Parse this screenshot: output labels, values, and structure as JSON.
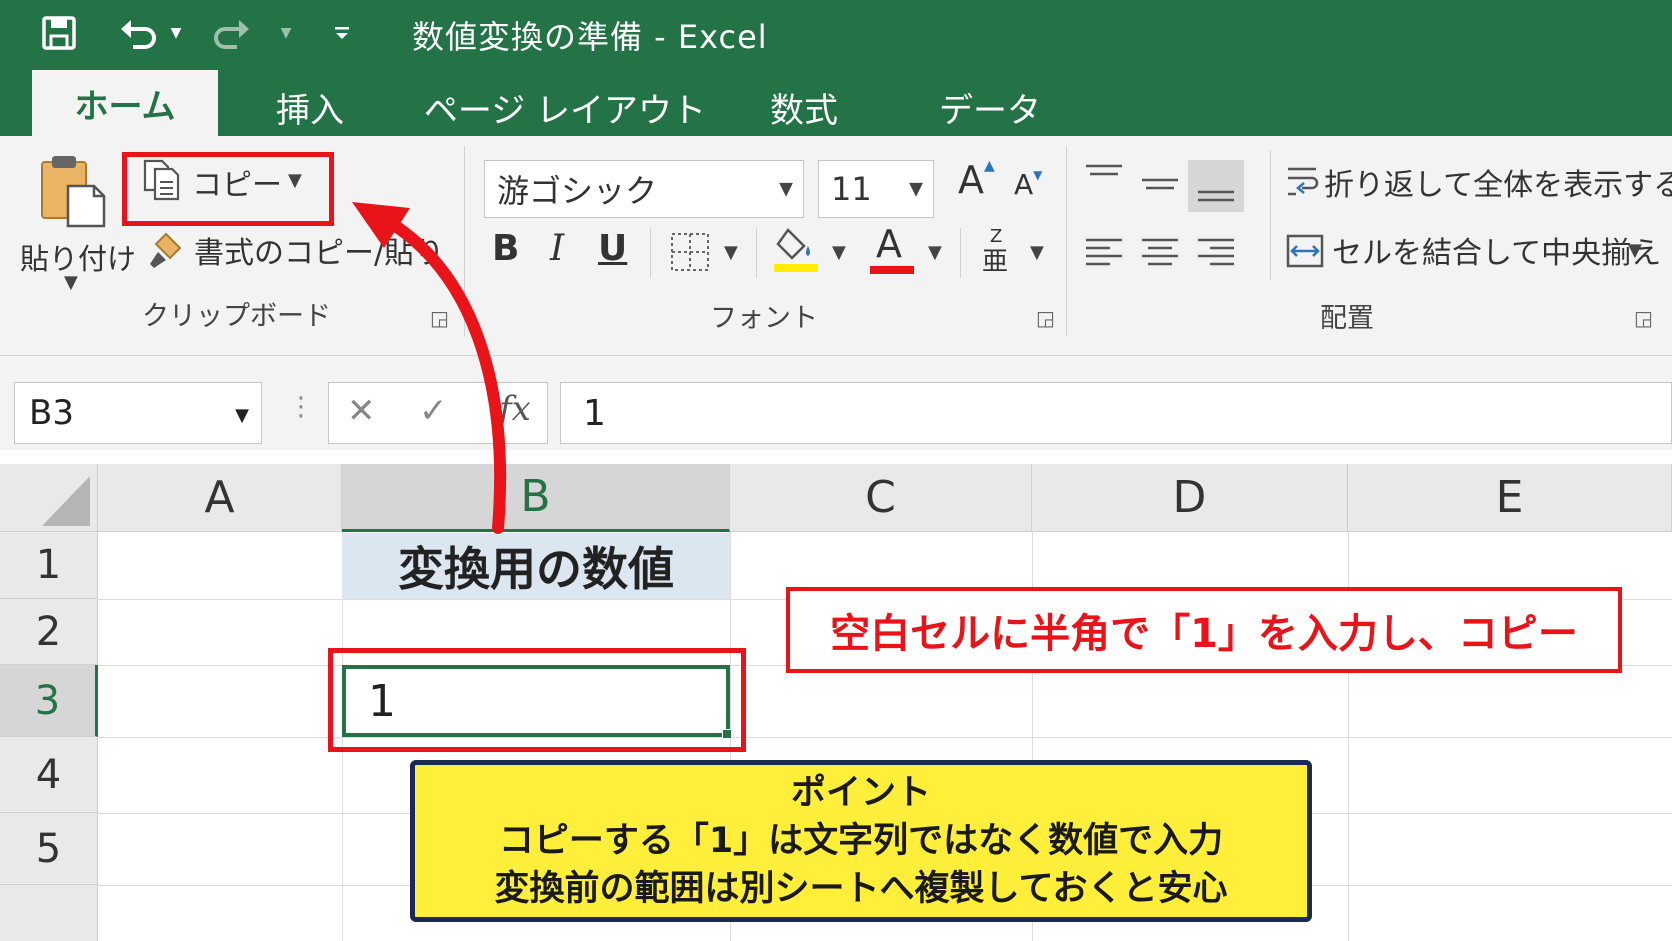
{
  "window": {
    "title": "数値変換の準備 - Excel"
  },
  "colors": {
    "excel_green": "#237346",
    "highlight_red": "#e8141a",
    "callout_yellow": "#ffef3a",
    "header_fill": "#dce6f1"
  },
  "tabs": [
    {
      "label": "ホーム",
      "active": true
    },
    {
      "label": "挿入"
    },
    {
      "label": "ページ レイアウト"
    },
    {
      "label": "数式"
    },
    {
      "label": "データ"
    }
  ],
  "ribbon": {
    "clipboard": {
      "paste_label": "貼り付け",
      "copy_label": "コピー",
      "format_painter_label": "書式のコピー/貼り付け",
      "group_label": "クリップボード"
    },
    "font": {
      "font_name": "游ゴシック",
      "font_size": "11",
      "bold": "B",
      "italic": "I",
      "underline": "U",
      "font_color_glyph": "A",
      "group_label": "フォント"
    },
    "alignment": {
      "wrap_text_label": "折り返して全体を表示する",
      "merge_center_label": "セルを結合して中央揃え",
      "group_label": "配置"
    }
  },
  "formula_bar": {
    "name_box": "B3",
    "fx": "fx",
    "value": "1"
  },
  "sheet": {
    "columns": [
      "A",
      "B",
      "C",
      "D",
      "E"
    ],
    "rows": [
      "1",
      "2",
      "3",
      "4",
      "5"
    ],
    "selected_cell": "B3",
    "cells": {
      "B1": "変換用の数値",
      "B3": "1"
    }
  },
  "annotations": {
    "instruction": "空白セルに半角で「1」を入力し、コピー",
    "point_title": "ポイント",
    "point_line1": "コピーする「1」は文字列ではなく数値で入力",
    "point_line2": "変換前の範囲は別シートへ複製しておくと安心"
  }
}
